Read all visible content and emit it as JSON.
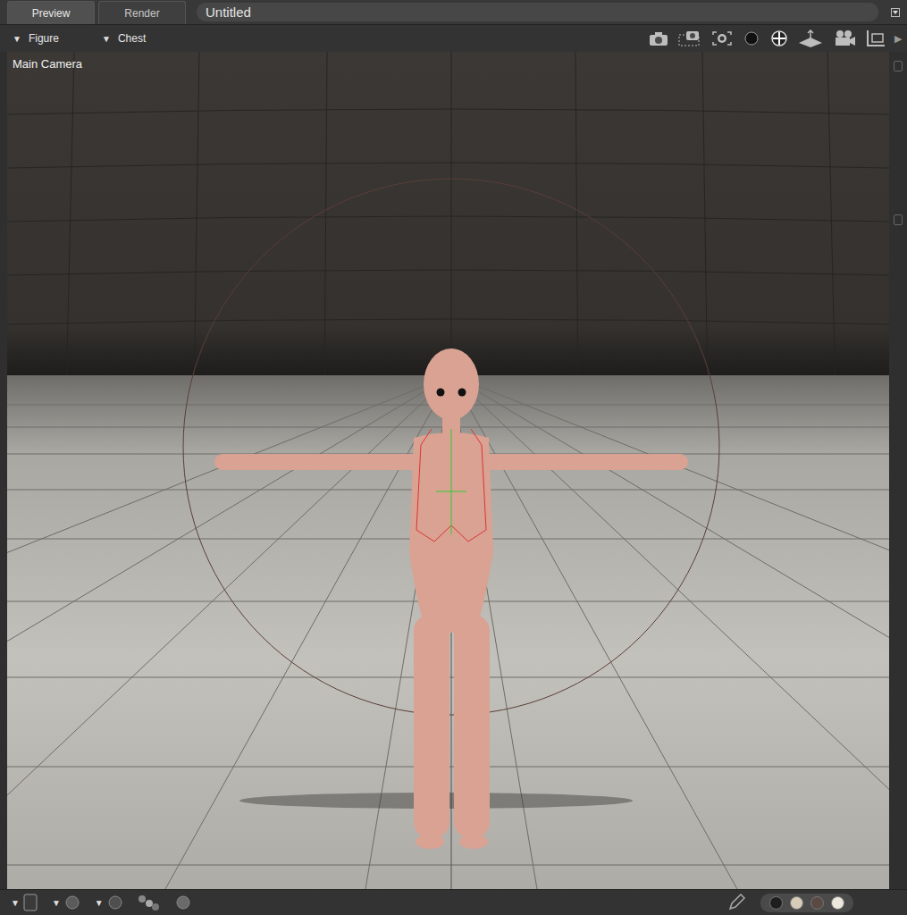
{
  "tabs": [
    {
      "label": "Preview",
      "selected": true
    },
    {
      "label": "Render",
      "selected": false
    }
  ],
  "document": {
    "title": "Untitled"
  },
  "selectors": [
    {
      "arrow": "▼",
      "label": "Figure"
    },
    {
      "arrow": "▼",
      "label": "Chest"
    }
  ],
  "toolbar": {
    "overflow": "▶"
  },
  "viewport": {
    "camera": "Main Camera"
  },
  "bottom_bar": {
    "arrows": [
      "▼",
      "▼",
      "▼"
    ]
  },
  "swatches": [
    {
      "color": "#1e1e1e"
    },
    {
      "color": "#d6ccb8"
    },
    {
      "color": "#5b4a44"
    },
    {
      "color": "#ece8de"
    }
  ]
}
